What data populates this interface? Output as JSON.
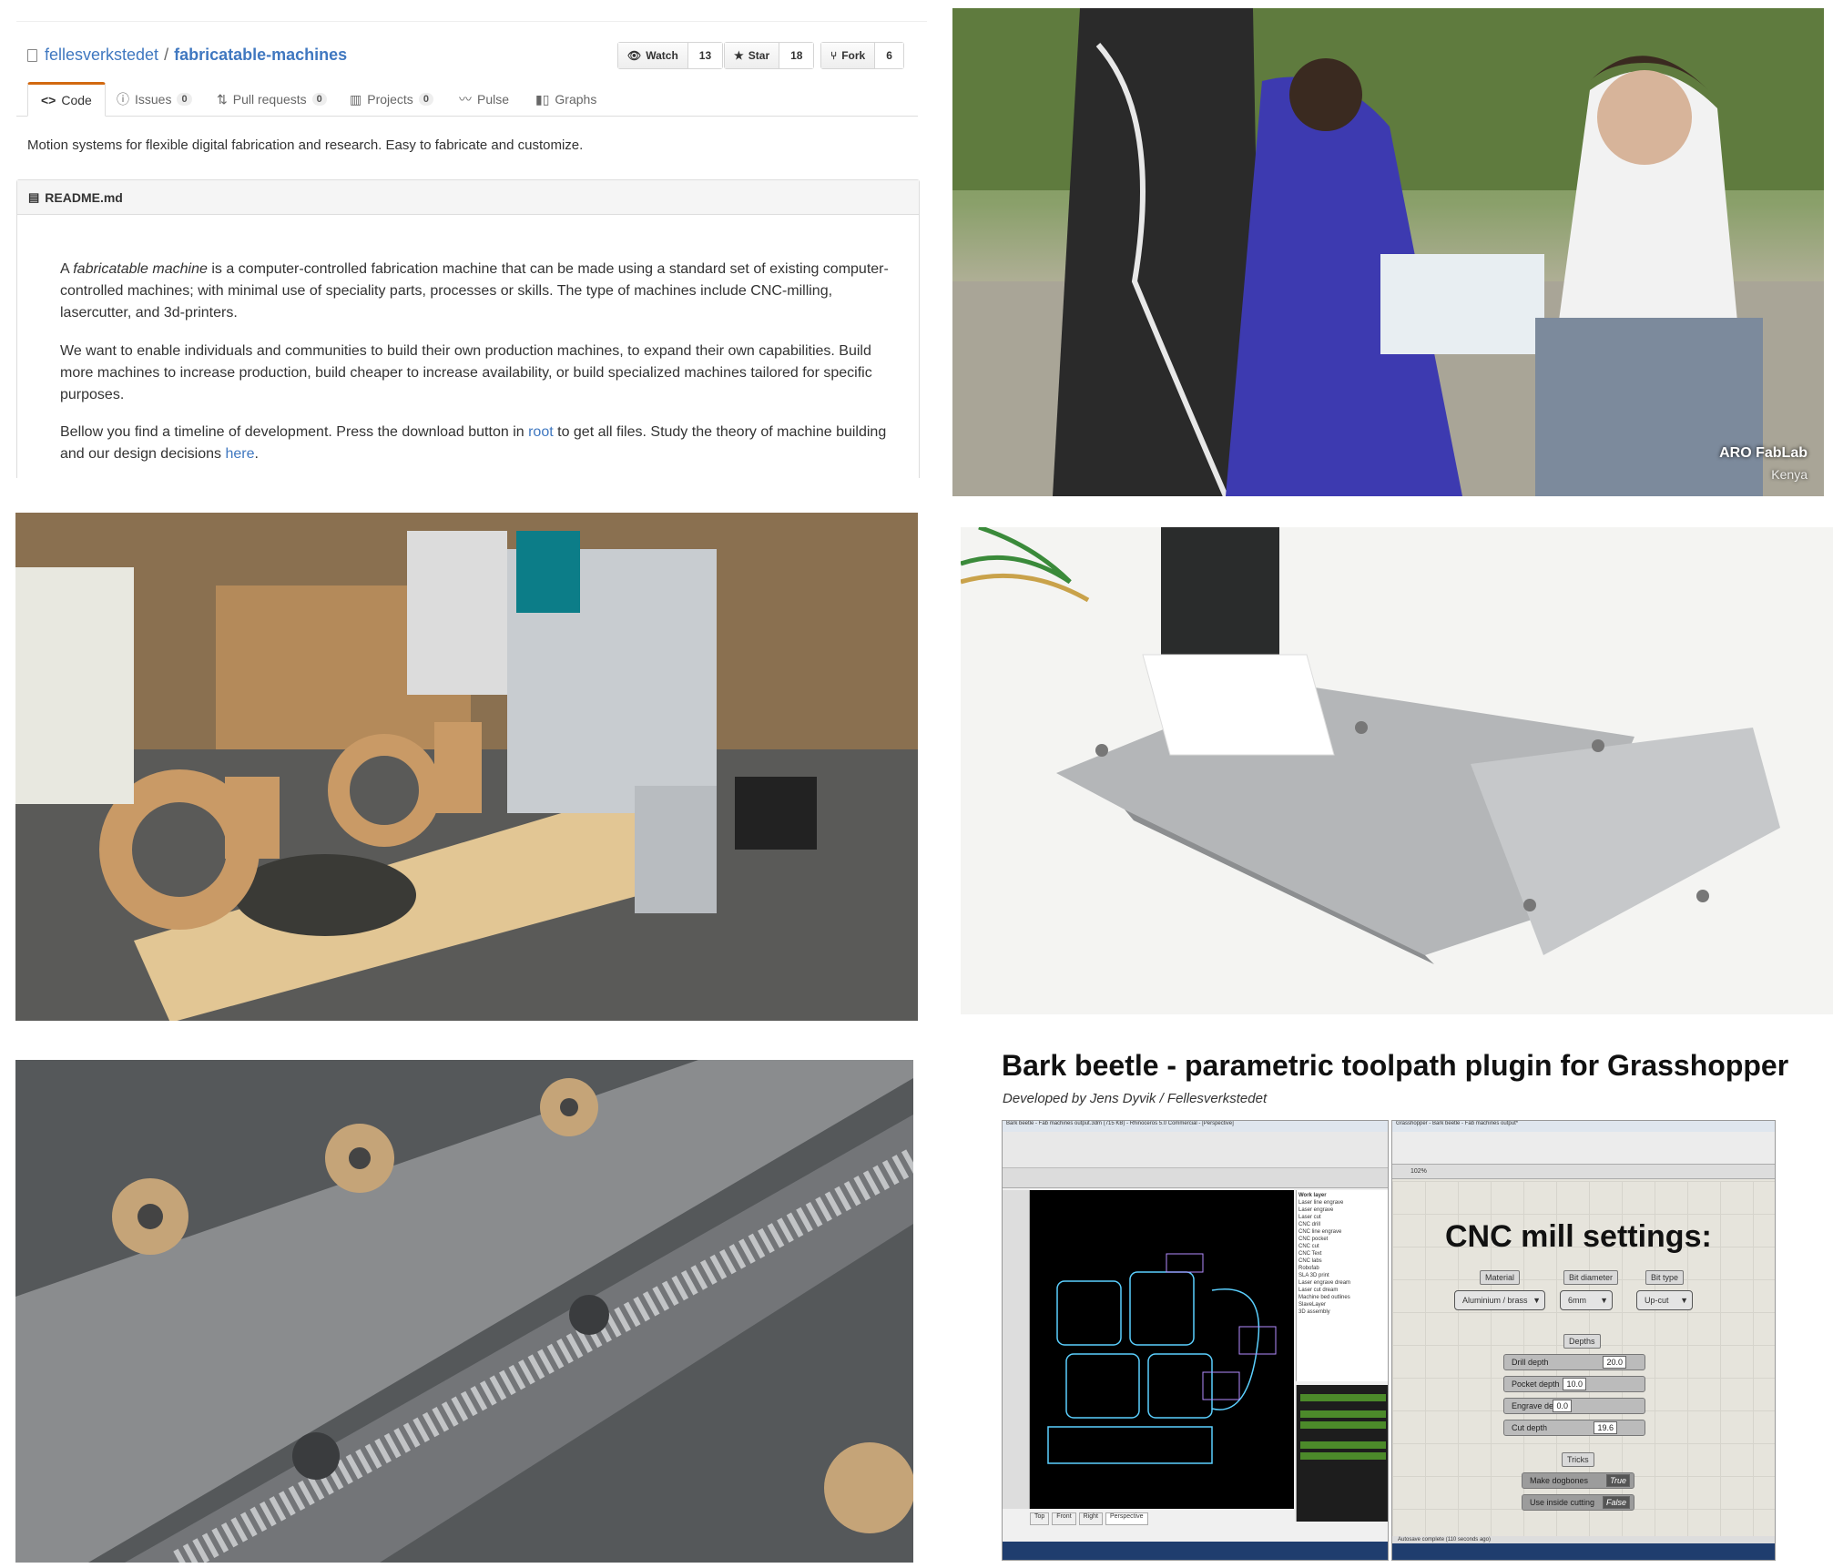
{
  "repo": {
    "owner": "fellesverkstedet",
    "separator": "/",
    "name": "fabricatable-machines",
    "watch_label": "Watch",
    "watch_count": "13",
    "star_label": "Star",
    "star_count": "18",
    "fork_label": "Fork",
    "fork_count": "6",
    "tabs": [
      {
        "label": "Code"
      },
      {
        "label": "Issues",
        "count": "0"
      },
      {
        "label": "Pull requests",
        "count": "0"
      },
      {
        "label": "Projects",
        "count": "0"
      },
      {
        "label": "Pulse"
      },
      {
        "label": "Graphs"
      }
    ],
    "description": "Motion systems for flexible digital fabrication and research. Easy to fabricate and customize.",
    "readme_title": "README.md",
    "p1_pre": "A ",
    "p1_em": "fabricatable machine",
    "p1_post": " is a computer-controlled fabrication machine that can be made using a standard set of existing computer-controlled machines; with minimal use of speciality parts, processes or skills. The type of machines include CNC-milling, lasercutter, and 3d-printers.",
    "p2": "We want to enable individuals and communities to build their own production machines, to expand their own capabilities. Build more machines to increase production, build cheaper to increase availability, or build specialized machines tailored for specific purposes.",
    "p3_pre": "Bellow you find a timeline of development. Press the download button in ",
    "p3_link1": "root",
    "p3_mid": " to get all files. Study the theory of machine building and our design decisions ",
    "p3_link2": "here",
    "p3_end": "."
  },
  "photo1": {
    "watermark_1": "ARO FabLab",
    "watermark_2": "Kenya"
  },
  "barkbeetle": {
    "title": "Bark beetle - parametric toolpath plugin for Grasshopper",
    "subtitle": "Developed by Jens Dyvik / Fellesverkstedet",
    "rhino_title": "Bark beetle - Fab machines output.3dm (715 KB) - Rhinoceros 5.0 Commercial - [Perspective]",
    "gh_title": "Grasshopper - Bark beetle - Fab machines output*",
    "canvas_heading": "CNC mill settings:",
    "material_label": "Material",
    "material_value": "Aluminium / brass",
    "bit_diameter_label": "Bit diameter",
    "bit_diameter_value": "6mm",
    "bit_type_label": "Bit type",
    "bit_type_value": "Up-cut",
    "depths_label": "Depths",
    "sliders": [
      {
        "label": "Drill depth",
        "value": "20.0"
      },
      {
        "label": "Pocket depth",
        "value": "10.0"
      },
      {
        "label": "Engrave depth",
        "value": "0.0"
      },
      {
        "label": "Cut depth",
        "value": "19.6"
      }
    ],
    "tricks_label": "Tricks",
    "toggles": [
      {
        "label": "Make dogbones",
        "value": "True"
      },
      {
        "label": "Use inside cutting",
        "value": "False"
      }
    ],
    "layers_header": "Work layer",
    "layers": [
      "Laser line engrave",
      "Laser engrave",
      "Laser cut",
      "CNC drill",
      "CNC line engrave",
      "CNC pocket",
      "CNC cut",
      "CNC Text",
      "CNC labs",
      "Robofab",
      "SLA 3D print",
      "Laser engrave dream",
      "Laser cut dream",
      "Machine bed outlines",
      "SlaveLayer",
      "3D assembly"
    ],
    "viewport_tabs": [
      "Top",
      "Front",
      "Right",
      "Perspective"
    ],
    "zoom": "102%",
    "status": "Autosave complete (110 seconds ago)"
  },
  "colors": {
    "github_link": "#4078c0",
    "tab_accent": "#d26911"
  }
}
